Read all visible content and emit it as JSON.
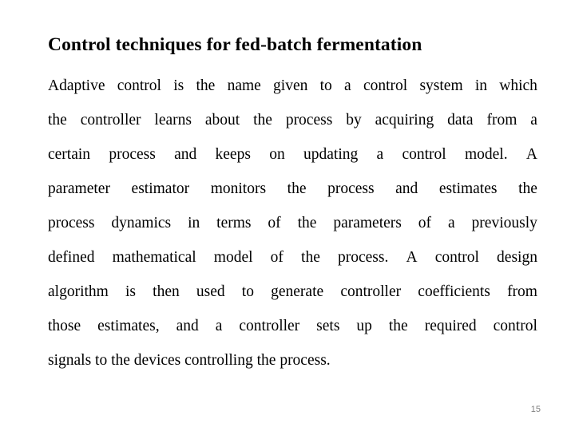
{
  "slide": {
    "title": "Control techniques for fed-batch fermentation",
    "page_number": "15",
    "background_color": "#ffffff",
    "text_color": "#000000",
    "page_number_color": "#808080",
    "body_paragraph": "Adaptive control is the name given to a control system in which the controller learns about the process by acquiring data from a certain process and keeps on updating a control model. A parameter estimator monitors the process and estimates the process dynamics in terms of the parameters of a previously defined mathematical model of the process. A control design algorithm is then used to generate controller coefficients from those estimates, and a controller sets up the required control signals to the devices controlling the process.",
    "body_lines": [
      {
        "text": "Adaptive control is the name given to a control system in which",
        "words": [
          "Adaptive",
          "control",
          "is",
          "the",
          "name",
          "given",
          "to",
          "a",
          "control",
          "system",
          "in",
          "which"
        ],
        "justified": true
      },
      {
        "text": "the controller learns about the process by acquiring data from a",
        "words": [
          "the",
          "controller",
          "learns",
          "about",
          "the",
          "process",
          "by",
          "acquiring",
          "data",
          "from",
          "a"
        ],
        "justified": true
      },
      {
        "text": "certain process and keeps on updating a control model. A",
        "words": [
          "certain",
          "process",
          "and",
          "keeps",
          "on",
          "updating",
          "a",
          "control",
          "model.",
          "A"
        ],
        "justified": true
      },
      {
        "text": "parameter estimator monitors the process and estimates the",
        "words": [
          "parameter",
          "estimator",
          "monitors",
          "the",
          "process",
          "and",
          "estimates",
          "the"
        ],
        "justified": true
      },
      {
        "text": "process dynamics in terms of the parameters of a previously",
        "words": [
          "process",
          "dynamics",
          "in",
          "terms",
          "of",
          "the",
          "parameters",
          "of",
          "a",
          "previously"
        ],
        "justified": true
      },
      {
        "text": "defined mathematical model of the process. A control design",
        "words": [
          "defined",
          "mathematical",
          "model",
          "of",
          "the",
          "process.",
          "A",
          "control",
          "design"
        ],
        "justified": true
      },
      {
        "text": "algorithm is then used to generate controller coefficients from",
        "words": [
          "algorithm",
          "is",
          "then",
          "used",
          "to",
          "generate",
          "controller",
          "coefficients",
          "from"
        ],
        "justified": true
      },
      {
        "text": "those estimates, and a controller sets up the required control",
        "words": [
          "those",
          "estimates,",
          "and",
          "a",
          "controller",
          "sets",
          "up",
          "the",
          "required",
          "control"
        ],
        "justified": true
      },
      {
        "text": "signals to the devices controlling the process.",
        "words": [
          "signals",
          "to",
          "the",
          "devices",
          "controlling",
          "the",
          "process."
        ],
        "justified": false
      }
    ]
  }
}
